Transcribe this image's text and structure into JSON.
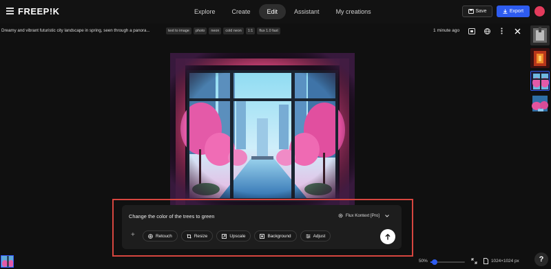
{
  "app": {
    "logo": "FREEP!K"
  },
  "nav": {
    "tabs": [
      {
        "label": "Explore"
      },
      {
        "label": "Create"
      },
      {
        "label": "Edit",
        "active": true
      },
      {
        "label": "Assistant"
      },
      {
        "label": "My creations"
      }
    ]
  },
  "toolbar": {
    "save_label": "Save",
    "export_label": "Export"
  },
  "info": {
    "description": "Dreamy and vibrant futuristic city landscape in spring, seen through a panora...",
    "tags": [
      "text to image",
      "photo",
      "neon",
      "cold neon",
      "1:1",
      "flux 1.0 fast"
    ],
    "time_ago": "1 minute ago"
  },
  "prompt": {
    "text": "Change the color of the trees to green",
    "model": "Flux Kontext [Pro]",
    "tools": [
      "Retouch",
      "Resize",
      "Upscale",
      "Background",
      "Adjust"
    ]
  },
  "footer": {
    "zoom": "50%",
    "zoom_fraction": 0.12,
    "dimensions": "1024×1024 px",
    "help": "?"
  },
  "colors": {
    "accent": "#2e5cf0",
    "highlight": "#d7463f",
    "avatar": "#e33b5c"
  }
}
